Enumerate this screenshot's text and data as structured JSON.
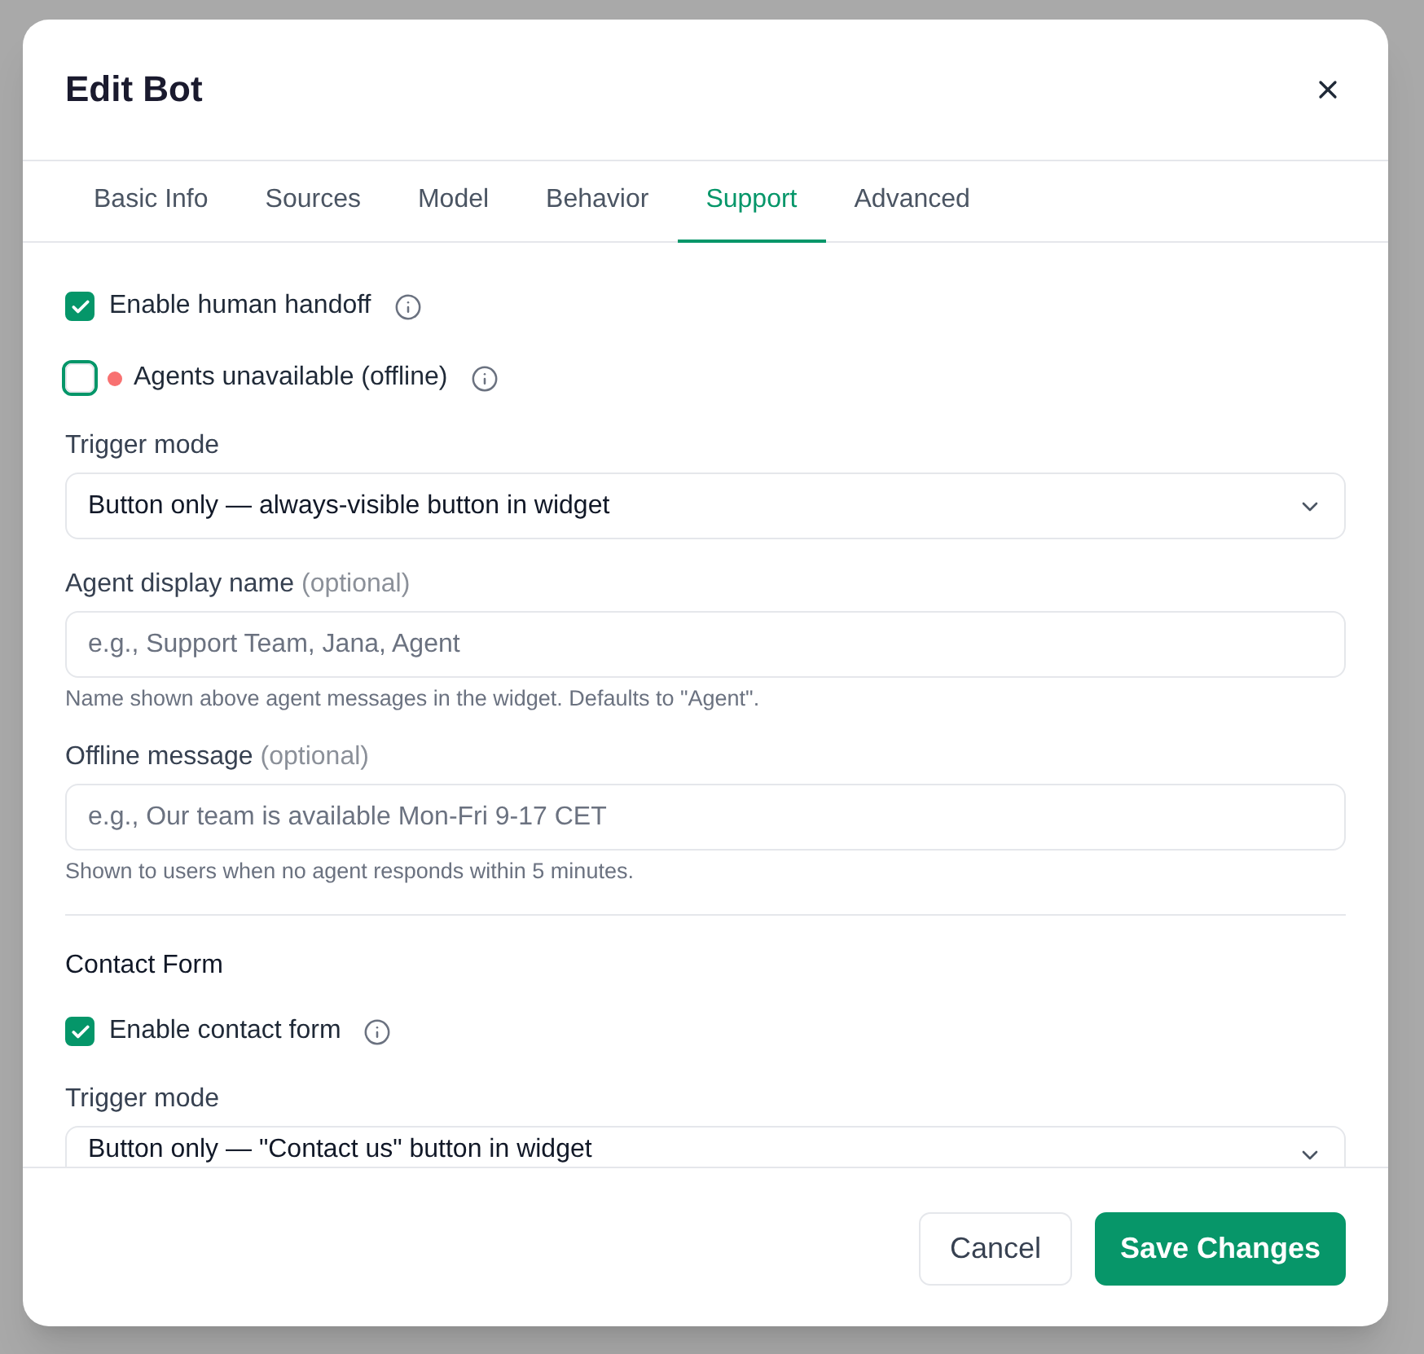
{
  "dialog": {
    "title": "Edit Bot"
  },
  "tabs": [
    {
      "label": "Basic Info",
      "selected": false
    },
    {
      "label": "Sources",
      "selected": false
    },
    {
      "label": "Model",
      "selected": false
    },
    {
      "label": "Behavior",
      "selected": false
    },
    {
      "label": "Support",
      "selected": true
    },
    {
      "label": "Advanced",
      "selected": false
    }
  ],
  "items": [
    {
      "kind": "checkbox",
      "label": "Enable human handoff",
      "checked": true,
      "focused": false
    },
    {
      "kind": "checkbox",
      "label": "Agents unavailable (offline)",
      "checked": false,
      "focused": true,
      "color": "#f87171"
    },
    {
      "kind": "select",
      "label": "Trigger mode",
      "value": "Button only — always-visible button in widget"
    },
    {
      "kind": "input",
      "label": "Agent display name",
      "optional": "(optional)",
      "placeholder": "e.g., Support Team, Jana, Agent",
      "help": "Name shown above agent messages in the widget. Defaults to \"Agent\"."
    },
    {
      "kind": "input",
      "label": "Offline message",
      "optional": "(optional)",
      "placeholder": "e.g., Our team is available Mon-Fri 9-17 CET",
      "help": "Shown to users when no agent responds within 5 minutes."
    },
    {
      "kind": "section",
      "title": "Contact Form"
    },
    {
      "kind": "checkbox",
      "label": "Enable contact form",
      "checked": true,
      "focused": false
    },
    {
      "kind": "select",
      "label": "Trigger mode",
      "value": "Button only — \"Contact us\" button in widget"
    }
  ],
  "footer": {
    "buttons": [
      {
        "label": "Cancel",
        "kind": "secondary"
      },
      {
        "label": "Save Changes",
        "kind": "primary"
      }
    ]
  }
}
